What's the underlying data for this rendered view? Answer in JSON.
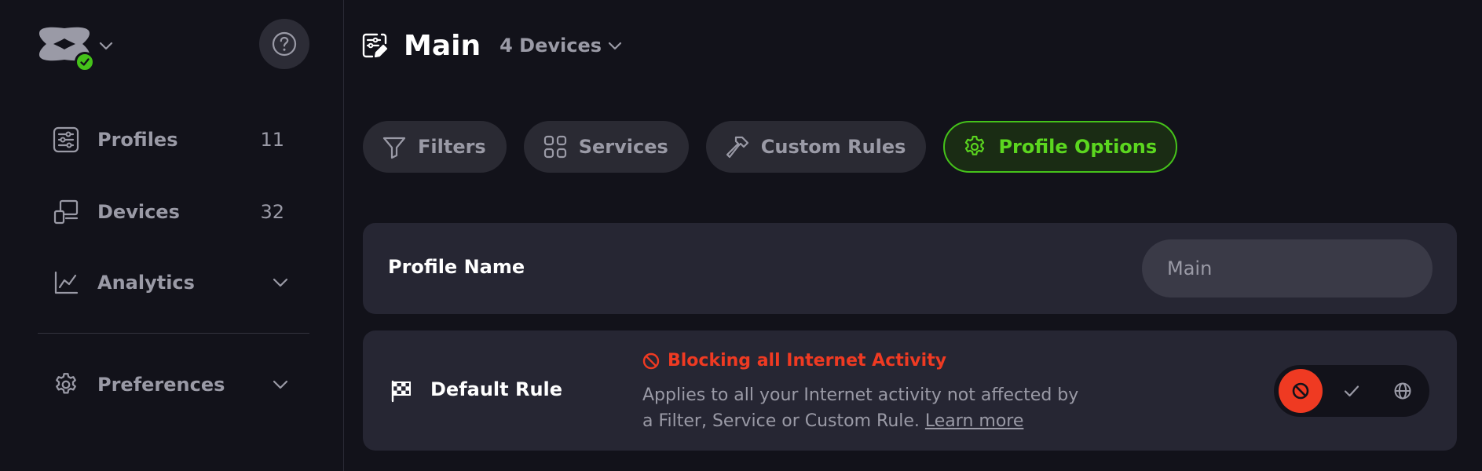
{
  "header": {
    "profile_name": "Main",
    "devices_label": "4 Devices"
  },
  "sidebar": {
    "items": [
      {
        "label": "Profiles",
        "count": "11",
        "icon": "sliders-icon"
      },
      {
        "label": "Devices",
        "count": "32",
        "icon": "devices-icon"
      },
      {
        "label": "Analytics",
        "icon": "chart-icon"
      },
      {
        "label": "Preferences",
        "icon": "gear-icon"
      }
    ]
  },
  "tabs": [
    {
      "label": "Filters",
      "icon": "filter-icon"
    },
    {
      "label": "Services",
      "icon": "grid-icon"
    },
    {
      "label": "Custom Rules",
      "icon": "hammer-icon"
    },
    {
      "label": "Profile Options",
      "icon": "gear-icon",
      "active": true
    }
  ],
  "profile_name_card": {
    "title": "Profile Name",
    "placeholder": "Main"
  },
  "default_rule_card": {
    "title": "Default Rule",
    "status": "Blocking all Internet Activity",
    "description": "Applies to all your Internet activity not affected by a Filter, Service or Custom Rule.",
    "learn_more": "Learn more",
    "options": [
      "block",
      "allow",
      "redirect"
    ],
    "selected": "block"
  },
  "colors": {
    "accent_green": "#45c21a",
    "block_red": "#ef3a22",
    "card_bg": "#262633",
    "page_bg": "#12121a"
  }
}
